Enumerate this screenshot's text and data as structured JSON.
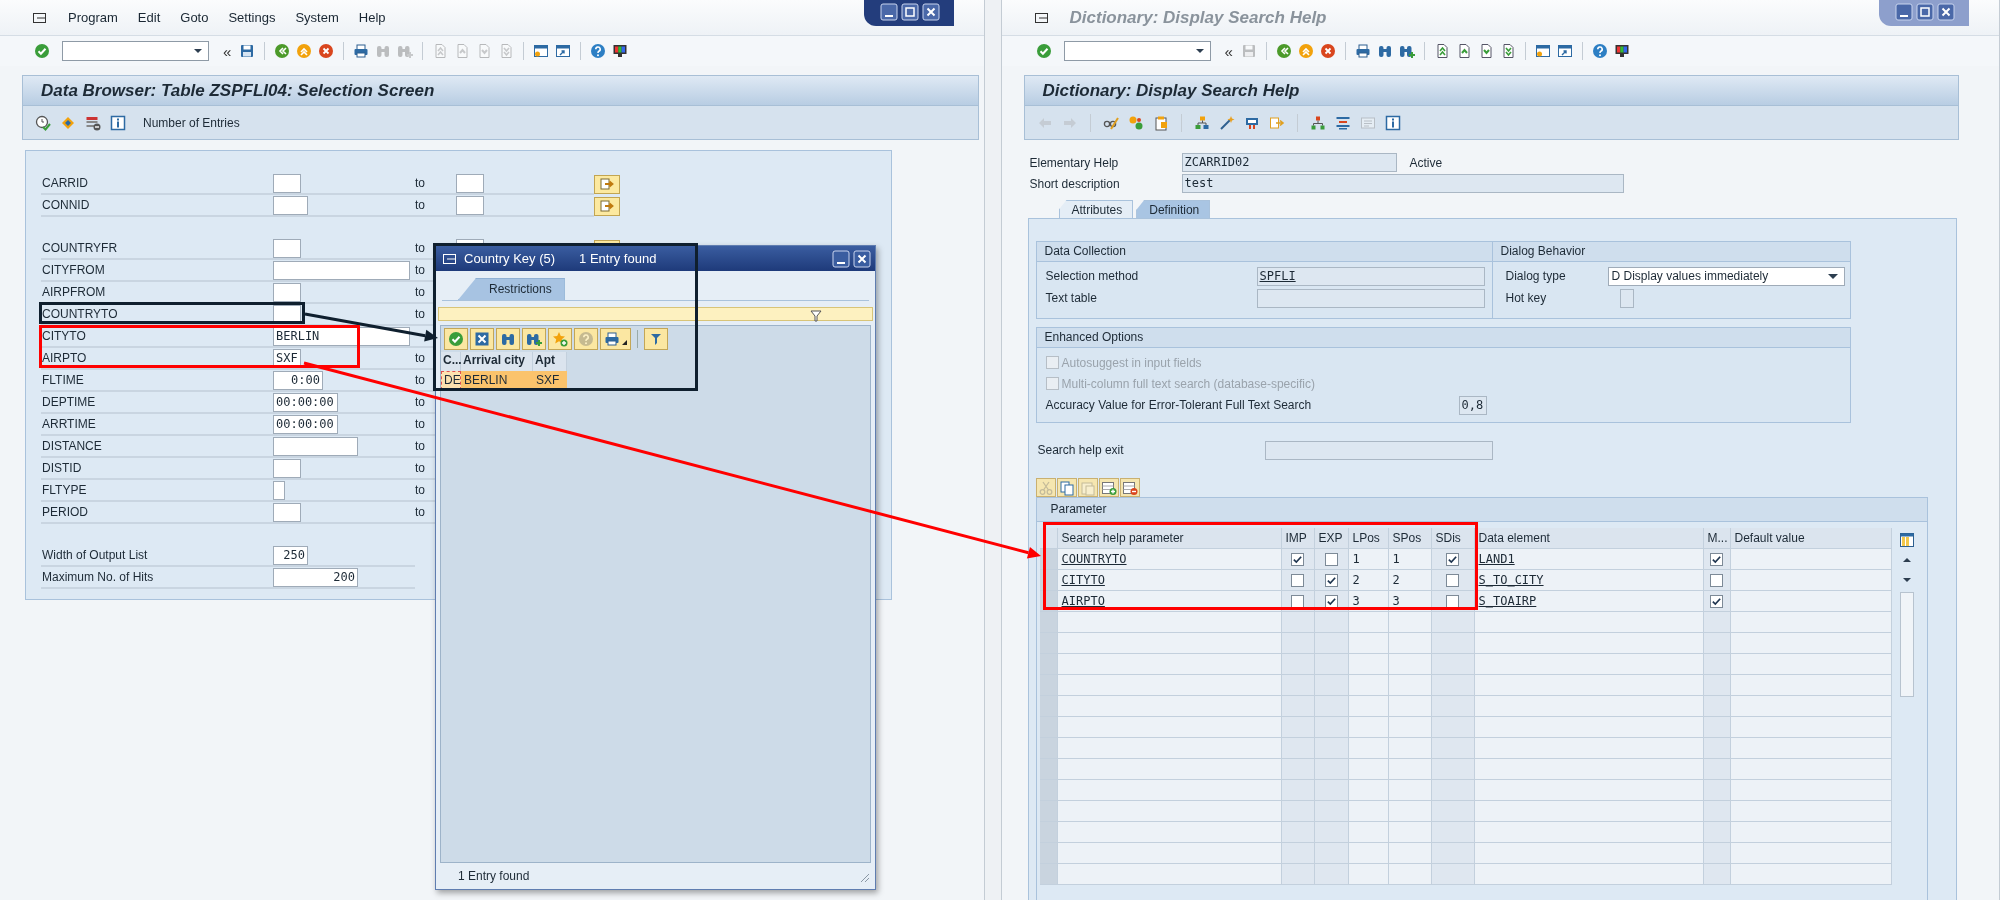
{
  "windows": [
    {
      "active": true,
      "kind": "selection",
      "menu": [
        {
          "label": "Program"
        },
        {
          "label": "Edit"
        },
        {
          "label": "Goto"
        },
        {
          "label": "Settings"
        },
        {
          "label": "System"
        },
        {
          "label": "Help"
        }
      ],
      "toolbar": [
        {
          "kind": "enter",
          "disabled": false
        },
        {
          "kind": "command"
        },
        {
          "kind": "glyph",
          "text": "«"
        },
        {
          "kind": "save",
          "disabled": false
        },
        {
          "kind": "sep"
        },
        {
          "kind": "back",
          "disabled": false
        },
        {
          "kind": "exit",
          "disabled": false
        },
        {
          "kind": "cancel",
          "disabled": false
        },
        {
          "kind": "sep"
        },
        {
          "kind": "print",
          "disabled": false
        },
        {
          "kind": "find",
          "disabled": true
        },
        {
          "kind": "find_next",
          "disabled": true
        },
        {
          "kind": "sep"
        },
        {
          "kind": "first",
          "disabled": true
        },
        {
          "kind": "prev",
          "disabled": true
        },
        {
          "kind": "next",
          "disabled": true
        },
        {
          "kind": "last",
          "disabled": true
        },
        {
          "kind": "sep"
        },
        {
          "kind": "new_session",
          "disabled": false
        },
        {
          "kind": "shortcut",
          "disabled": false
        },
        {
          "kind": "sep"
        },
        {
          "kind": "help",
          "disabled": false
        },
        {
          "kind": "customize",
          "disabled": false
        }
      ],
      "screen_title": "Data Browser: Table ZSPFLI04: Selection Screen",
      "app_toolbar": [
        {
          "kind": "execute"
        },
        {
          "kind": "variants"
        },
        {
          "kind": "selopts"
        },
        {
          "kind": "info"
        },
        {
          "kind": "button",
          "text": "Number of Entries"
        }
      ],
      "form": {
        "rows": [
          {
            "label": "CARRID",
            "to": "to",
            "kind": "full"
          },
          {
            "label": "CONNID",
            "to": "to",
            "kind": "full"
          },
          {
            "label": "COUNTRYFR",
            "to": "to",
            "kind": "clipped"
          },
          {
            "label": "CITYFROM",
            "to": "to",
            "kind": "partial"
          },
          {
            "label": "AIRPFROM",
            "to": "to",
            "kind": "partial"
          },
          {
            "label": "COUNTRYTO",
            "to": "to",
            "kind": "partial"
          },
          {
            "label": "CITYTO",
            "value": "BERLIN",
            "kind": "partial"
          },
          {
            "label": "AIRPTO",
            "value": "SXF",
            "to": "to",
            "kind": "partial"
          },
          {
            "label": "FLTIME",
            "value": "0:00",
            "to": "to",
            "kind": "partial"
          },
          {
            "label": "DEPTIME",
            "value": "00:00:00",
            "to": "to",
            "kind": "partial"
          },
          {
            "label": "ARRTIME",
            "value": "00:00:00",
            "to": "to",
            "kind": "partial"
          },
          {
            "label": "DISTANCE",
            "to": "to",
            "kind": "partial"
          },
          {
            "label": "DISTID",
            "to": "to",
            "kind": "partial"
          },
          {
            "label": "FLTYPE",
            "to": "to",
            "kind": "partial"
          },
          {
            "label": "PERIOD",
            "to": "to",
            "kind": "partial"
          },
          {
            "label": "Width of Output List",
            "value": "250",
            "kind": "single"
          },
          {
            "label": "Maximum No. of Hits",
            "value": "200",
            "kind": "single"
          }
        ]
      }
    },
    {
      "active": false,
      "kind": "search_help",
      "title": "Dictionary: Display Search Help",
      "toolbar": [
        {
          "kind": "enter",
          "disabled": false
        },
        {
          "kind": "command"
        },
        {
          "kind": "glyph",
          "text": "«"
        },
        {
          "kind": "save",
          "disabled": true
        },
        {
          "kind": "sep"
        },
        {
          "kind": "back",
          "disabled": false
        },
        {
          "kind": "exit",
          "disabled": false
        },
        {
          "kind": "cancel",
          "disabled": false
        },
        {
          "kind": "sep"
        },
        {
          "kind": "print",
          "disabled": false
        },
        {
          "kind": "find",
          "disabled": false
        },
        {
          "kind": "find_next",
          "disabled": false
        },
        {
          "kind": "sep"
        },
        {
          "kind": "first",
          "disabled": false
        },
        {
          "kind": "prev",
          "disabled": false
        },
        {
          "kind": "next",
          "disabled": false
        },
        {
          "kind": "last",
          "disabled": false
        },
        {
          "kind": "sep"
        },
        {
          "kind": "new_session",
          "disabled": false
        },
        {
          "kind": "shortcut",
          "disabled": false
        },
        {
          "kind": "sep"
        },
        {
          "kind": "help",
          "disabled": false
        },
        {
          "kind": "customize",
          "disabled": false
        }
      ],
      "screen_title": "Dictionary: Display Search Help",
      "app_toolbar": [
        {
          "kind": "nav_back",
          "disabled": true
        },
        {
          "kind": "nav_forward",
          "disabled": true
        },
        {
          "kind": "sep"
        },
        {
          "kind": "display_change",
          "disabled": false
        },
        {
          "kind": "active_toggle",
          "disabled": false
        },
        {
          "kind": "other_object",
          "disabled": false
        },
        {
          "kind": "sep"
        },
        {
          "kind": "where_used",
          "disabled": false
        },
        {
          "kind": "activate",
          "disabled": false
        },
        {
          "kind": "test",
          "disabled": false
        },
        {
          "kind": "move",
          "disabled": false
        },
        {
          "kind": "sep"
        },
        {
          "kind": "hierarchy",
          "disabled": false
        },
        {
          "kind": "layout",
          "disabled": false
        },
        {
          "kind": "form",
          "disabled": true
        },
        {
          "kind": "info",
          "disabled": false
        }
      ],
      "search_help": {
        "header": [
          {
            "label": "Elementary Help",
            "value": "ZCARRID02",
            "status": "Active"
          },
          {
            "label": "Short description",
            "value": "test"
          }
        ],
        "tabs": [
          {
            "label": "Attributes",
            "selected": false
          },
          {
            "label": "Definition",
            "selected": true
          }
        ],
        "data_collection": {
          "title": "Data Collection",
          "fields": [
            {
              "label": "Selection method",
              "value": "SPFLI"
            },
            {
              "label": "Text table"
            }
          ]
        },
        "dialog_behavior": {
          "title": "Dialog Behavior",
          "fields": [
            {
              "label": "Dialog type",
              "value": "D Display values immediately",
              "kind": "dropdown"
            },
            {
              "label": "Hot key",
              "kind": "input"
            }
          ]
        },
        "enhanced_options": {
          "title": "Enhanced Options",
          "options": [
            {
              "label": "Autosuggest in input fields",
              "checked": false,
              "disabled": true
            },
            {
              "label": "Multi-column full text search (database-specific)",
              "checked": false,
              "disabled": true
            }
          ],
          "accuracy": {
            "label": "Accuracy Value for Error-Tolerant Full Text Search",
            "value": "0,8"
          }
        },
        "exit": {
          "label": "Search help exit"
        },
        "table_toolbar": [
          {
            "kind": "cut",
            "disabled": true
          },
          {
            "kind": "copy",
            "disabled": false
          },
          {
            "kind": "paste",
            "disabled": true
          },
          {
            "kind": "insert_row",
            "disabled": false
          },
          {
            "kind": "delete_row",
            "disabled": false
          }
        ],
        "parameters": {
          "title": "Parameter",
          "columns": [
            "Search help parameter",
            "IMP",
            "EXP",
            "LPos",
            "SPos",
            "SDis",
            "Data element",
            "M...",
            "Default value"
          ],
          "rows": [
            {
              "parameter": "COUNTRYTO",
              "imp": true,
              "exp": false,
              "lpos": "1",
              "spos": "1",
              "sdis": true,
              "data_element": "LAND1",
              "mandatory": true
            },
            {
              "parameter": "CITYTO",
              "imp": false,
              "exp": true,
              "lpos": "2",
              "spos": "2",
              "sdis": false,
              "data_element": "S_TO_CITY",
              "mandatory": false
            },
            {
              "parameter": "AIRPTO",
              "imp": false,
              "exp": true,
              "lpos": "3",
              "spos": "3",
              "sdis": false,
              "data_element": "S_TOAIRP",
              "mandatory": true
            }
          ]
        }
      }
    }
  ],
  "popup": {
    "title": "Country Key (5)",
    "subtitle": "1 Entry found",
    "tabs": [
      {
        "label": "Restrictions",
        "selected": true
      }
    ],
    "toolbar": [
      {
        "kind": "enter",
        "disabled": false
      },
      {
        "kind": "close",
        "disabled": false
      },
      {
        "kind": "find",
        "disabled": false
      },
      {
        "kind": "find_next",
        "disabled": false
      },
      {
        "kind": "favorite",
        "disabled": false
      },
      {
        "kind": "help",
        "disabled": true
      },
      {
        "kind": "print_menu",
        "disabled": false
      },
      {
        "kind": "sep"
      },
      {
        "kind": "filter",
        "disabled": false
      }
    ],
    "columns": [
      "C...",
      "Arrival city",
      "Apt"
    ],
    "rows": [
      {
        "cells": [
          "DE",
          "BERLIN",
          "SXF"
        ],
        "selected": true
      }
    ],
    "status": "1 Entry found"
  },
  "annotations": [
    {
      "kind": "frame",
      "color": "#0f1f2e"
    },
    {
      "kind": "frame",
      "color": "#0f1f2e"
    },
    {
      "kind": "arrow",
      "color": "#0f1f2e"
    },
    {
      "kind": "frame",
      "color": "#ff0000"
    },
    {
      "kind": "arrow",
      "color": "#ff0000"
    },
    {
      "kind": "frame",
      "color": "#ff0000"
    }
  ]
}
